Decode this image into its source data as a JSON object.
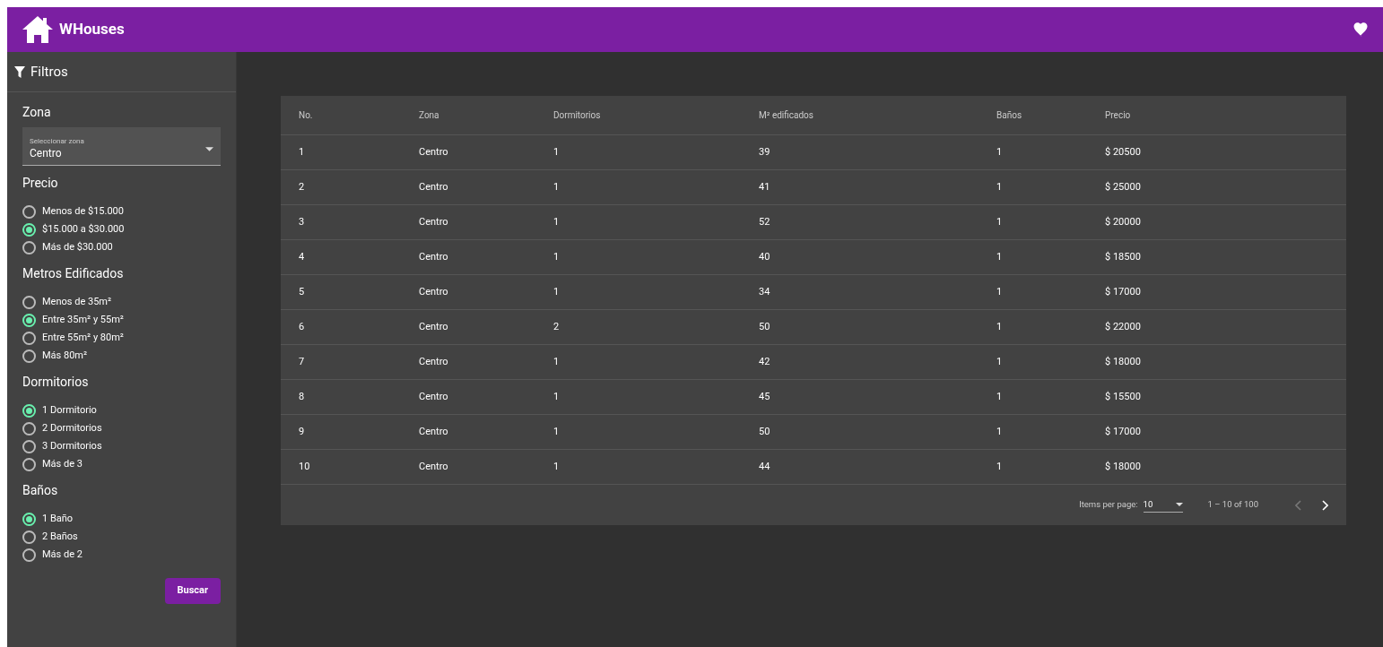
{
  "app_bar": {
    "title": "WHouses"
  },
  "sidebar": {
    "title": "Filtros",
    "zone": {
      "heading": "Zona",
      "label": "Seleccionar zona",
      "value": "Centro"
    },
    "groups": [
      {
        "heading": "Precio",
        "options": [
          {
            "label": "Menos de $15.000",
            "selected": false
          },
          {
            "label": "$15.000 a $30.000",
            "selected": true
          },
          {
            "label": "Más de $30.000",
            "selected": false
          }
        ]
      },
      {
        "heading": "Metros Edificados",
        "options": [
          {
            "label": "Menos de 35m²",
            "selected": false
          },
          {
            "label": "Entre 35m² y 55m²",
            "selected": true
          },
          {
            "label": "Entre 55m² y 80m²",
            "selected": false
          },
          {
            "label": "Más 80m²",
            "selected": false
          }
        ]
      },
      {
        "heading": "Dormitorios",
        "options": [
          {
            "label": "1 Dormitorio",
            "selected": true
          },
          {
            "label": "2 Dormitorios",
            "selected": false
          },
          {
            "label": "3 Dormitorios",
            "selected": false
          },
          {
            "label": "Más de 3",
            "selected": false
          }
        ]
      },
      {
        "heading": "Baños",
        "options": [
          {
            "label": "1 Baño",
            "selected": true
          },
          {
            "label": "2 Baños",
            "selected": false
          },
          {
            "label": "Más de 2",
            "selected": false
          }
        ]
      }
    ],
    "search_button": "Buscar"
  },
  "table": {
    "columns": [
      "No.",
      "Zona",
      "Dormitorios",
      "M² edificados",
      "Baños",
      "Precio"
    ],
    "rows": [
      [
        "1",
        "Centro",
        "1",
        "39",
        "1",
        "$ 20500"
      ],
      [
        "2",
        "Centro",
        "1",
        "41",
        "1",
        "$ 25000"
      ],
      [
        "3",
        "Centro",
        "1",
        "52",
        "1",
        "$ 20000"
      ],
      [
        "4",
        "Centro",
        "1",
        "40",
        "1",
        "$ 18500"
      ],
      [
        "5",
        "Centro",
        "1",
        "34",
        "1",
        "$ 17000"
      ],
      [
        "6",
        "Centro",
        "2",
        "50",
        "1",
        "$ 22000"
      ],
      [
        "7",
        "Centro",
        "1",
        "42",
        "1",
        "$ 18000"
      ],
      [
        "8",
        "Centro",
        "1",
        "45",
        "1",
        "$ 15500"
      ],
      [
        "9",
        "Centro",
        "1",
        "50",
        "1",
        "$ 17000"
      ],
      [
        "10",
        "Centro",
        "1",
        "44",
        "1",
        "$ 18000"
      ]
    ]
  },
  "paginator": {
    "items_label": "Items per page:",
    "page_size": "10",
    "range": "1 – 10 of 100",
    "previous": {
      "disabled": true
    },
    "next": {
      "disabled": false
    }
  }
}
